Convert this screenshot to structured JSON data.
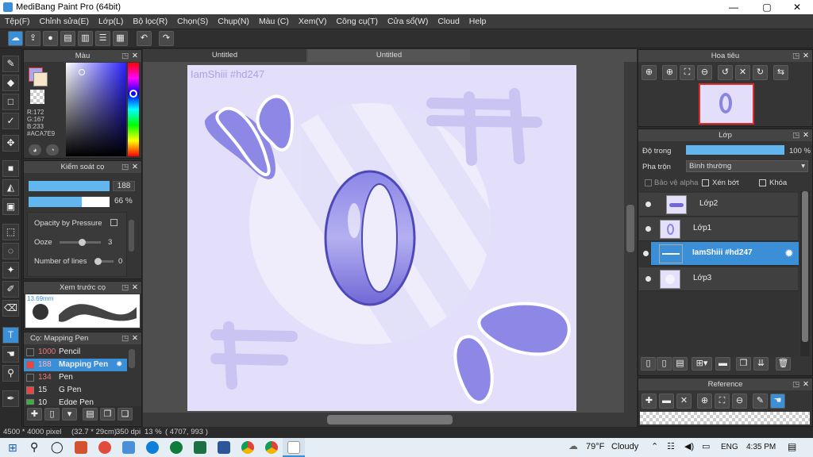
{
  "window": {
    "title": "MediBang Paint Pro (64bit)",
    "min": "—",
    "max": "▢",
    "close": "✕"
  },
  "menu": [
    "Tệp(F)",
    "Chỉnh sửa(E)",
    "Lớp(L)",
    "Bộ lọc(R)",
    "Chọn(S)",
    "Chụp(N)",
    "Màu (C)",
    "Xem(V)",
    "Công cụ(T)",
    "Cửa sổ(W)",
    "Cloud",
    "Help"
  ],
  "panels": {
    "color": {
      "title": "Màu",
      "r": "R:172",
      "g": "G:167",
      "b": "B:233",
      "hex": "#ACA7E9",
      "primary": "#ACA7E9"
    },
    "brush_control": {
      "title": "Kiểm soát cọ",
      "size": "188",
      "opacity": "66 %",
      "opacity_pressure": "Opacity by Pressure",
      "ooze_label": "Ooze",
      "ooze_value": "3",
      "lines_label": "Number of lines",
      "lines_value": "0"
    },
    "brush_preview": {
      "title": "Xem trước cọ",
      "size": "13.69mm"
    },
    "brushes": {
      "title": "Cọ: Mapping Pen",
      "items": [
        {
          "size": "1000",
          "name": "Pencil",
          "color": "#333333"
        },
        {
          "size": "188",
          "name": "Mapping Pen",
          "color": "#e84545"
        },
        {
          "size": "134",
          "name": "Pen",
          "color": "#333333"
        },
        {
          "size": "15",
          "name": "G Pen",
          "color": "#e84545"
        },
        {
          "size": "10",
          "name": "Edge Pen",
          "color": "#44aa44"
        }
      ]
    },
    "navigator": {
      "title": "Hoa tiêu"
    },
    "layers": {
      "title": "Lớp",
      "opacity_label": "Độ trong",
      "opacity_value": "100 %",
      "blend_label": "Pha trộn",
      "blend_value": "Bình thường",
      "protect_alpha": "Bảo vệ alpha",
      "clipping": "Xén bớt",
      "lock": "Khóa",
      "items": [
        {
          "name": "Lớp2",
          "selected": false
        },
        {
          "name": "Lớp1",
          "selected": false
        },
        {
          "name": "IamShiii #hd247",
          "selected": true
        },
        {
          "name": "Lớp3",
          "selected": false
        }
      ]
    },
    "reference": {
      "title": "Reference"
    }
  },
  "tabs": [
    "Untitled",
    "Untitled"
  ],
  "canvas": {
    "watermark": "IamShiii #hd247"
  },
  "status": {
    "size": "4500 * 4000 pixel",
    "dims": "(32.7 * 29cm)",
    "dpi": "350 dpi",
    "zoom": "13 %",
    "coords": "( 4707, 993 )"
  },
  "taskbar": {
    "weather_temp": "79°F",
    "weather_text": "Cloudy",
    "lang": "ENG",
    "time": "4:35 PM"
  }
}
